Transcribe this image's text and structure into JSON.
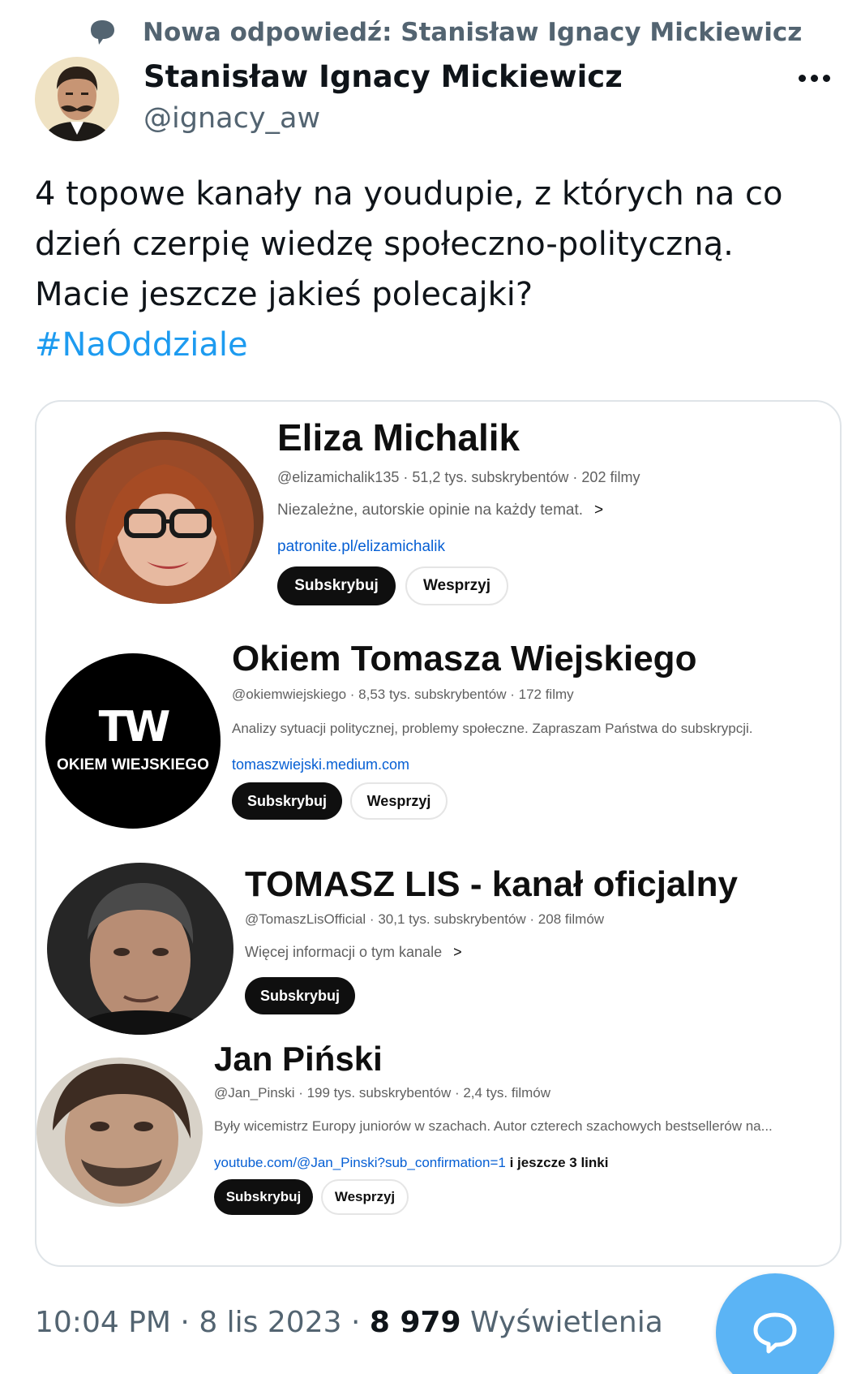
{
  "reply_context": {
    "text": "Nowa odpowiedź: Stanisław Ignacy Mickiewicz",
    "icon": "speech-bubble-icon"
  },
  "author": {
    "name": "Stanisław Ignacy Mickiewicz",
    "handle": "@ignacy_aw"
  },
  "tweet": {
    "lines": [
      "4 topowe kanały na youdupie, z których na co",
      "dzień czerpię wiedzę społeczno-polityczną.",
      "Macie jeszcze jakieś polecajki?"
    ],
    "hashtag": "#NaOddziale"
  },
  "channels": [
    {
      "name": "Eliza Michalik",
      "meta": "@elizamichalik135 · 51,2 tys. subskrybentów · 202 filmy",
      "description": "Niezależne, autorskie opinie na każdy temat.",
      "link": "patronite.pl/elizamichalik",
      "subscribe": "Subskrybuj",
      "support": "Wesprzyj"
    },
    {
      "name": "Okiem Tomasza Wiejskiego",
      "meta": "@okiemwiejskiego · 8,53 tys. subskrybentów · 172 filmy",
      "description": "Analizy sytuacji politycznej, problemy społeczne. Zapraszam Państwa do subskrypcji.",
      "link": "tomaszwiejski.medium.com",
      "subscribe": "Subskrybuj",
      "support": "Wesprzyj",
      "logo_big": "TW",
      "logo_small": "OKIEM WIEJSKIEGO"
    },
    {
      "name": "TOMASZ LIS - kanał oficjalny",
      "meta": "@TomaszLisOfficial · 30,1 tys. subskrybentów · 208 filmów",
      "description": "Więcej informacji o tym kanale",
      "subscribe": "Subskrybuj"
    },
    {
      "name": "Jan Piński",
      "meta": "@Jan_Pinski · 199 tys. subskrybentów · 2,4 tys. filmów",
      "description": "Były wicemistrz Europy juniorów w szachach. Autor czterech szachowych bestsellerów na...",
      "link": "youtube.com/@Jan_Pinski?sub_confirmation=1",
      "link_extra": "i jeszcze 3 linki",
      "subscribe": "Subskrybuj",
      "support": "Wesprzyj"
    }
  ],
  "footer": {
    "time": "10:04 PM",
    "sep": "·",
    "date": "8 lis 2023",
    "views_count": "8 979",
    "views_label": "Wyświetlenia"
  },
  "colors": {
    "accent": "#1d9bf0",
    "fab": "#5bb4f5",
    "muted": "#536471",
    "yt_link": "#065fd4"
  }
}
